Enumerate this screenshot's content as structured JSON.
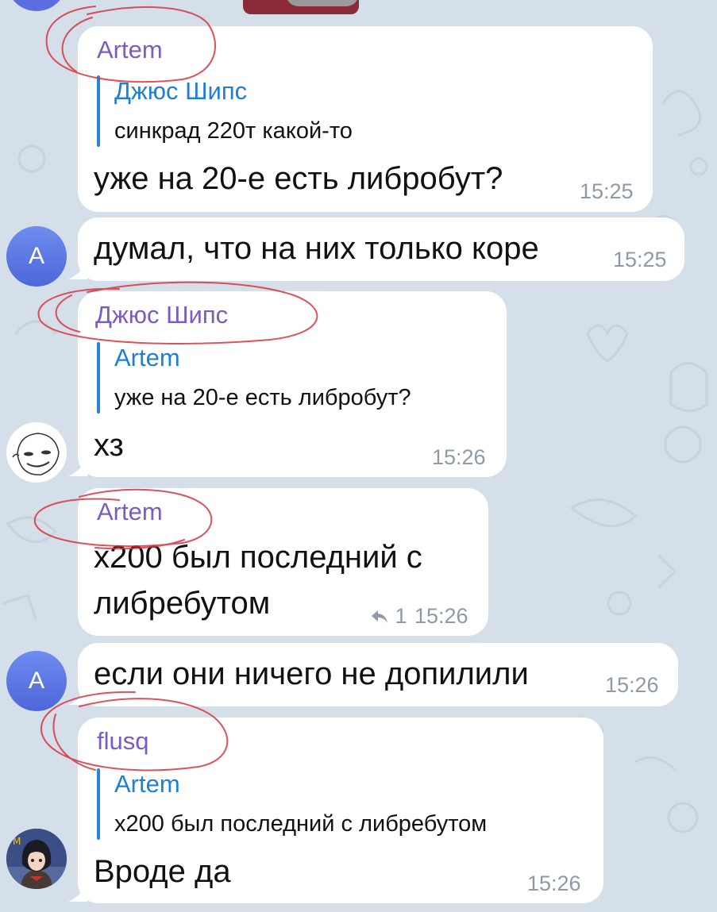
{
  "chat": {
    "top_avatar_color": "#5a6ee0",
    "messages": [
      {
        "sender": "Artem",
        "reply_to_name": "Джюс Шипс",
        "reply_to_text": "синкрад 220т какой-то",
        "text": "уже на 20-е есть либробут?",
        "time": "15:25"
      },
      {
        "avatar_letter": "A",
        "text": "думал, что на них только коре",
        "time": "15:25"
      },
      {
        "sender": "Джюс Шипс",
        "reply_to_name": "Artem",
        "reply_to_text": "уже на 20-е есть либробут?",
        "text": "хз",
        "time": "15:26"
      },
      {
        "sender": "Artem",
        "text_line1": "x200 был последний с",
        "text_line2": "либребутом",
        "reply_count": "1",
        "time": "15:26"
      },
      {
        "avatar_letter": "A",
        "text": "если они ничего не допилили",
        "time": "15:26"
      },
      {
        "sender": "flusq",
        "reply_to_name": "Artem",
        "reply_to_text": "x200 был последний с либребутом",
        "text": "Вроде да",
        "time": "15:26"
      }
    ]
  },
  "colors": {
    "sender_name": "#7b5bc4",
    "reply_name": "#1f7fd6",
    "timestamp": "#8e9aa6",
    "scribble": "#d9333f",
    "bubble": "#ffffff",
    "wallpaper": "#d4dfe9"
  },
  "icons": [
    "reply-arrow-icon",
    "avatar-letter-a",
    "avatar-meme-face",
    "avatar-anime-girl"
  ]
}
